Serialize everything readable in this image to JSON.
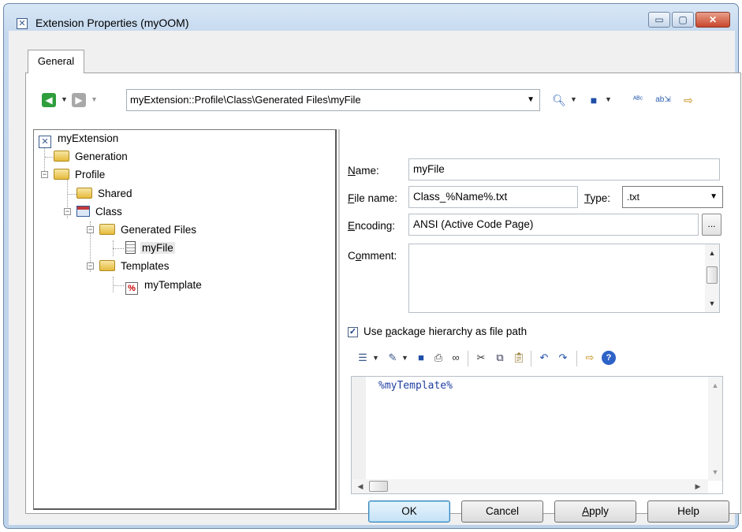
{
  "window": {
    "title": "Extension Properties (myOOM)",
    "caption_buttons": {
      "minimize": "▭",
      "maximize": "▢",
      "close": "✕"
    }
  },
  "tabs": [
    {
      "label": "General",
      "active": true
    }
  ],
  "toolbar": {
    "back_icon": "back-arrow-icon",
    "forward_icon": "forward-arrow-icon",
    "path": "myExtension::Profile\\Class\\Generated Files\\myFile",
    "icons": [
      "find-icon",
      "save-icon",
      "spell-check-icon",
      "replace-icon",
      "insert-icon"
    ]
  },
  "tree": {
    "nodes": [
      {
        "label": "myExtension",
        "icon": "extension-icon"
      },
      {
        "label": "Generation",
        "icon": "folder-icon"
      },
      {
        "label": "Profile",
        "icon": "folder-icon"
      },
      {
        "label": "Shared",
        "icon": "folder-icon"
      },
      {
        "label": "Class",
        "icon": "class-icon"
      },
      {
        "label": "Generated Files",
        "icon": "folder-icon"
      },
      {
        "label": "myFile",
        "icon": "file-icon",
        "selected": true
      },
      {
        "label": "Templates",
        "icon": "folder-icon"
      },
      {
        "label": "myTemplate",
        "icon": "template-icon"
      }
    ]
  },
  "form": {
    "name_label_u": "N",
    "name_label_rest": "ame:",
    "name_value": "myFile",
    "filename_label_u": "F",
    "filename_label_rest": "ile name:",
    "filename_value": "Class_%Name%.txt",
    "type_label_u": "T",
    "type_label_rest": "ype:",
    "type_value": ".txt",
    "encoding_label_u": "E",
    "encoding_label_rest": "ncoding:",
    "encoding_value": "ANSI (Active Code Page)",
    "encoding_button": "...",
    "comment_label_pre": "C",
    "comment_label_u": "o",
    "comment_label_rest": "mment:",
    "comment_value": "",
    "use_package_checked": true,
    "use_package_pre": "Use ",
    "use_package_u": "p",
    "use_package_rest": "ackage hierarchy as file path"
  },
  "editor": {
    "icons": [
      "properties-icon",
      "edit-icon",
      "save-icon",
      "print-icon",
      "find-icon",
      "cut-icon",
      "copy-icon",
      "paste-icon",
      "undo-icon",
      "redo-icon",
      "insert-icon",
      "help-icon"
    ],
    "content": "%myTemplate%"
  },
  "buttons": {
    "ok": "OK",
    "cancel": "Cancel",
    "apply_u": "A",
    "apply_rest": "pply",
    "help": "Help"
  }
}
